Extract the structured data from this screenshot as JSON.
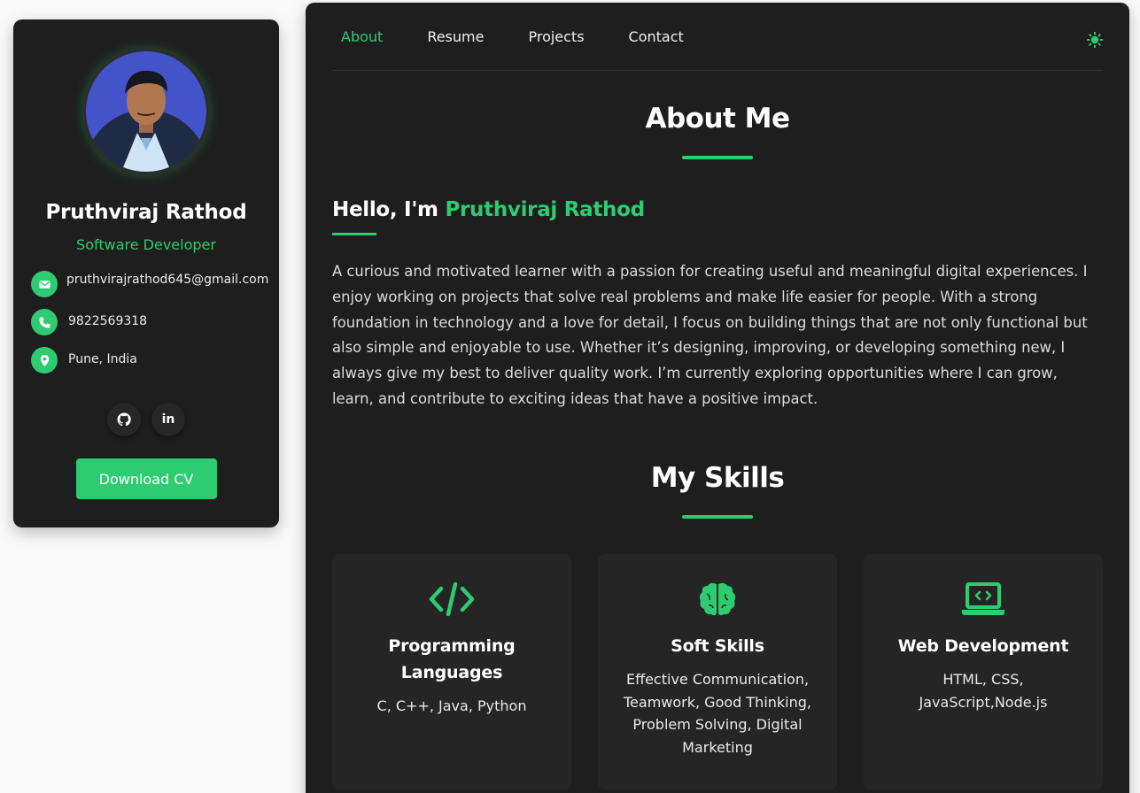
{
  "profile": {
    "name": "Pruthviraj Rathod",
    "role": "Software Developer",
    "email": "pruthvirajrathod645@gmail.com",
    "phone": "9822569318",
    "location": "Pune, India",
    "download_label": "Download CV"
  },
  "nav": {
    "items": [
      {
        "label": "About",
        "active": true
      },
      {
        "label": "Resume",
        "active": false
      },
      {
        "label": "Projects",
        "active": false
      },
      {
        "label": "Contact",
        "active": false
      }
    ]
  },
  "about": {
    "title": "About Me",
    "hello_prefix": "Hello, I'm",
    "hello_name": "Pruthviraj Rathod",
    "bio": "A curious and motivated learner with a passion for creating useful and meaningful digital experiences. I enjoy working on projects that solve real problems and make life easier for people. With a strong foundation in technology and a love for detail, I focus on building things that are not only functional but also simple and enjoyable to use. Whether it’s designing, improving, or developing something new, I always give my best to deliver quality work. I’m currently exploring opportunities where I can grow, learn, and contribute to exciting ideas that have a positive impact."
  },
  "skills": {
    "title": "My Skills",
    "cards": [
      {
        "title": "Programming Languages",
        "desc": "C, C++, Java, Python",
        "icon": "code-icon"
      },
      {
        "title": "Soft Skills",
        "desc": "Effective Communication, Teamwork, Good Thinking, Problem Solving, Digital Marketing",
        "icon": "brain-icon"
      },
      {
        "title": "Web Development",
        "desc": "HTML, CSS, JavaScript,Node.js",
        "icon": "laptop-code-icon"
      }
    ]
  },
  "colors": {
    "accent": "#2ecc71",
    "card_bg": "#1e1e1e",
    "page_bg": "#fafafa"
  }
}
